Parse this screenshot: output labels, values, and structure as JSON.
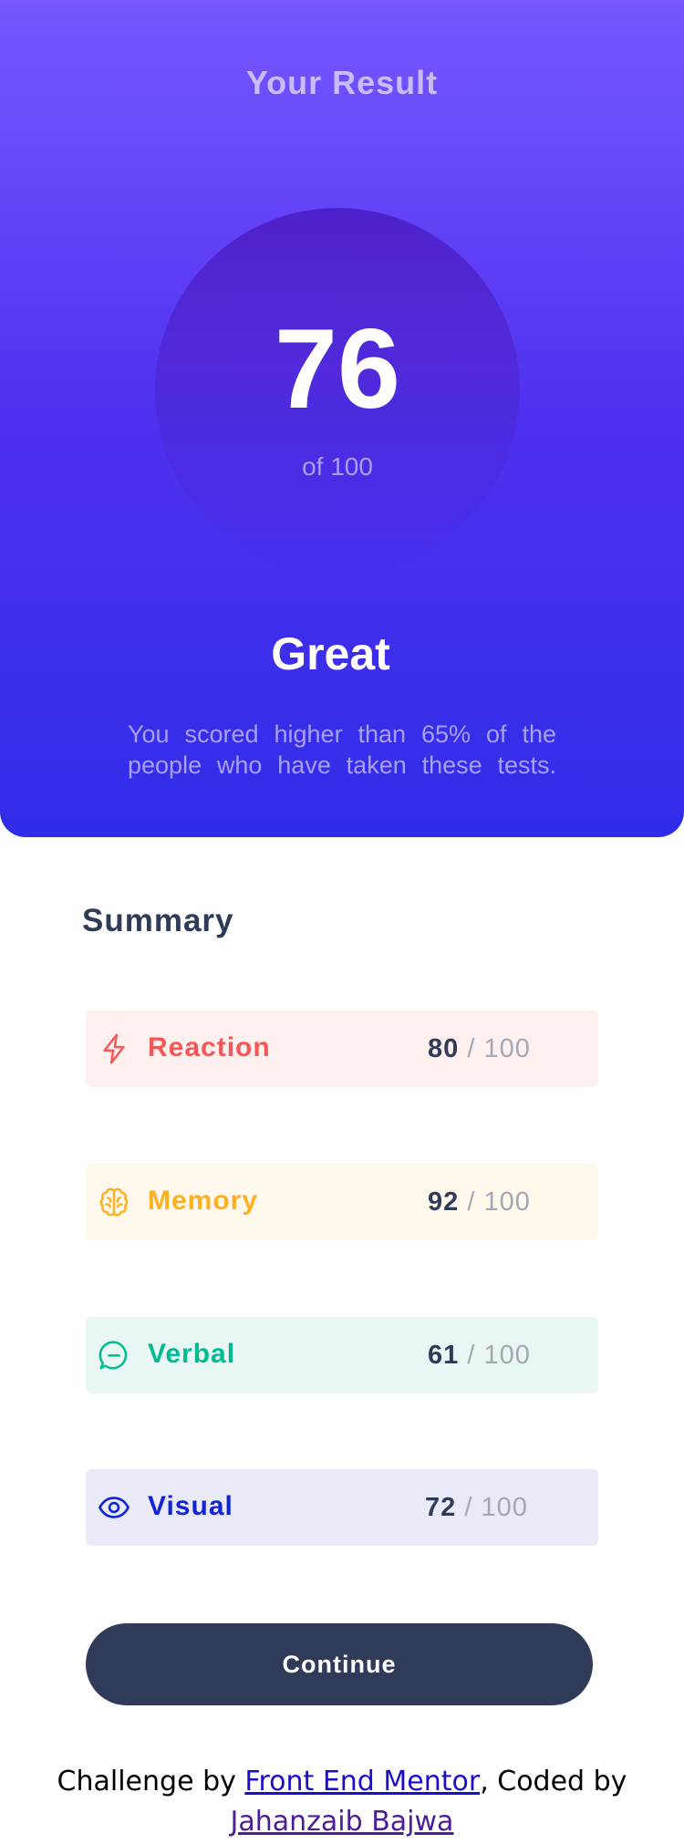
{
  "result": {
    "heading": "Your Result",
    "score": "76",
    "score_total": "of 100",
    "rating": "Great",
    "description": "You scored higher than 65% of the people who have taken these tests."
  },
  "summary": {
    "title": "Summary",
    "items": [
      {
        "label": "Reaction",
        "score": "80",
        "separator": "/",
        "max": "100",
        "icon": "lightning-icon",
        "color": "#f55757",
        "bg": "#fff0f0"
      },
      {
        "label": "Memory",
        "score": "92",
        "separator": "/",
        "max": "100",
        "icon": "brain-icon",
        "color": "#ffb01f",
        "bg": "#fff8ec"
      },
      {
        "label": "Verbal",
        "score": "61",
        "separator": "/",
        "max": "100",
        "icon": "chat-bubble-icon",
        "color": "#00bb8f",
        "bg": "#e8f7f3"
      },
      {
        "label": "Visual",
        "score": "72",
        "separator": "/",
        "max": "100",
        "icon": "eye-icon",
        "color": "#1125d6",
        "bg": "#e9e9f8"
      }
    ],
    "continue_label": "Continue"
  },
  "attribution": {
    "prefix": "Challenge by ",
    "link1": "Front End Mentor",
    "middle": ", Coded by ",
    "link2": "Jahanzaib Bajwa"
  },
  "colors": {
    "gradient_top": "#7857ff",
    "gradient_bottom": "#2f2de8",
    "dark_navy": "#303b5a"
  }
}
